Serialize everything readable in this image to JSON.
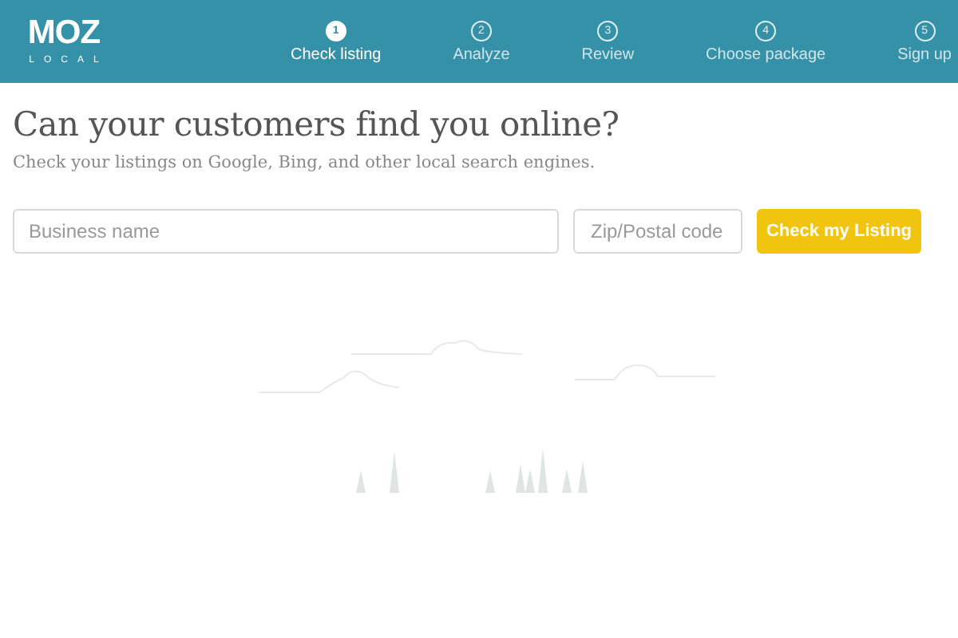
{
  "header": {
    "logo": "MOZ",
    "logo_sub": "LOCAL",
    "steps": [
      {
        "number": "1",
        "label": "Check listing",
        "selected": true
      },
      {
        "number": "2",
        "label": "Analyze",
        "selected": false
      },
      {
        "number": "3",
        "label": "Review",
        "selected": false
      },
      {
        "number": "4",
        "label": "Choose package",
        "selected": false
      },
      {
        "number": "5",
        "label": "Sign up",
        "selected": false
      }
    ]
  },
  "headline": "Can your customers find you online?",
  "subheadline": "Check your listings on Google, Bing, and other local search engines.",
  "form": {
    "business": {
      "placeholder": "Business name"
    },
    "zip": {
      "placeholder": "Zip/Postal code"
    },
    "button": "Check my Listing"
  }
}
